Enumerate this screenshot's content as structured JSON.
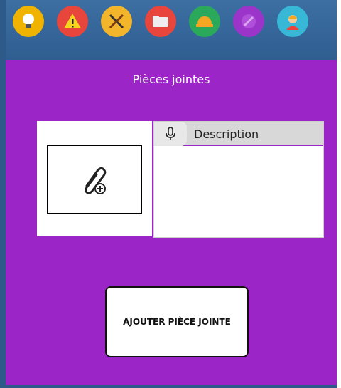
{
  "toolbar": {
    "items": [
      {
        "icon": "lightbulb-icon",
        "bg": "#f0b400"
      },
      {
        "icon": "warning-icon",
        "bg": "#e8453c"
      },
      {
        "icon": "tools-icon",
        "bg": "#f2b52b"
      },
      {
        "icon": "folder-icon",
        "bg": "#e8453c"
      },
      {
        "icon": "hardhat-icon",
        "bg": "#2aa95a"
      },
      {
        "icon": "pencil-icon",
        "bg": "#9b35c9"
      },
      {
        "icon": "worker-avatar-icon",
        "bg": "#36b8d6"
      }
    ]
  },
  "panel": {
    "title": "Pièces jointes",
    "background": "#9b25c6"
  },
  "description": {
    "label": "Description",
    "value": ""
  },
  "actions": {
    "add_attachment_label": "AJOUTER PIÈCE JOINTE"
  }
}
